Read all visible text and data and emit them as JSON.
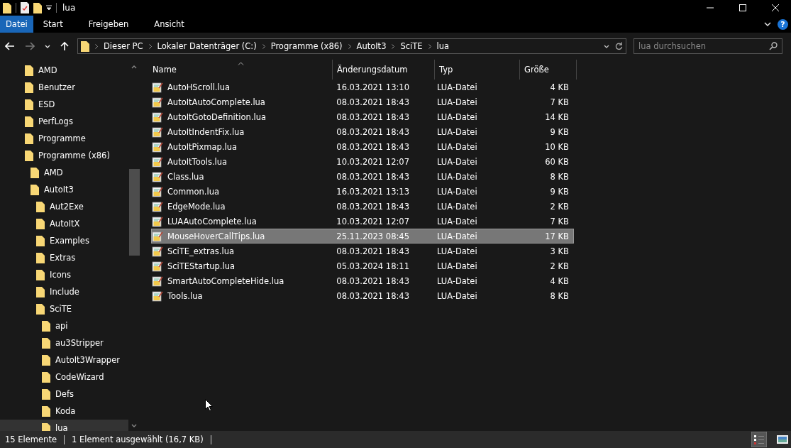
{
  "window": {
    "title": "lua"
  },
  "ribbon": {
    "tabs": [
      {
        "label": "Datei",
        "selected": true
      },
      {
        "label": "Start",
        "selected": false
      },
      {
        "label": "Freigeben",
        "selected": false
      },
      {
        "label": "Ansicht",
        "selected": false
      }
    ],
    "help": "?"
  },
  "address_bar": {
    "breadcrumbs": [
      "Dieser PC",
      "Lokaler Datenträger (C:)",
      "Programme (x86)",
      "AutoIt3",
      "SciTE",
      "lua"
    ]
  },
  "search": {
    "placeholder": "lua durchsuchen"
  },
  "sidebar": {
    "items": [
      {
        "label": "AMD",
        "selected": false
      },
      {
        "label": "Benutzer",
        "selected": false
      },
      {
        "label": "ESD",
        "selected": false
      },
      {
        "label": "PerfLogs",
        "selected": false
      },
      {
        "label": "Programme",
        "selected": false
      },
      {
        "label": "Programme (x86)",
        "selected": false,
        "children": [
          {
            "label": "AMD",
            "selected": false
          },
          {
            "label": "AutoIt3",
            "selected": false,
            "children": [
              {
                "label": "Aut2Exe",
                "selected": false
              },
              {
                "label": "AutoItX",
                "selected": false
              },
              {
                "label": "Examples",
                "selected": false
              },
              {
                "label": "Extras",
                "selected": false
              },
              {
                "label": "Icons",
                "selected": false
              },
              {
                "label": "Include",
                "selected": false
              },
              {
                "label": "SciTE",
                "selected": false,
                "children": [
                  {
                    "label": "api",
                    "selected": false
                  },
                  {
                    "label": "au3Stripper",
                    "selected": false
                  },
                  {
                    "label": "AutoIt3Wrapper",
                    "selected": false
                  },
                  {
                    "label": "CodeWizard",
                    "selected": false
                  },
                  {
                    "label": "Defs",
                    "selected": false
                  },
                  {
                    "label": "Koda",
                    "selected": false
                  },
                  {
                    "label": "lua",
                    "selected": true
                  }
                ]
              }
            ]
          }
        ]
      }
    ]
  },
  "table": {
    "columns": [
      "Name",
      "Änderungsdatum",
      "Typ",
      "Größe"
    ],
    "rows": [
      {
        "name": "AutoHScroll.lua",
        "date": "16.03.2021 13:10",
        "type": "LUA-Datei",
        "size": "4 KB",
        "selected": false
      },
      {
        "name": "AutoItAutoComplete.lua",
        "date": "08.03.2021 18:43",
        "type": "LUA-Datei",
        "size": "7 KB",
        "selected": false
      },
      {
        "name": "AutoItGotoDefinition.lua",
        "date": "08.03.2021 18:43",
        "type": "LUA-Datei",
        "size": "14 KB",
        "selected": false
      },
      {
        "name": "AutoItIndentFix.lua",
        "date": "08.03.2021 18:43",
        "type": "LUA-Datei",
        "size": "9 KB",
        "selected": false
      },
      {
        "name": "AutoItPixmap.lua",
        "date": "08.03.2021 18:43",
        "type": "LUA-Datei",
        "size": "10 KB",
        "selected": false
      },
      {
        "name": "AutoItTools.lua",
        "date": "10.03.2021 12:07",
        "type": "LUA-Datei",
        "size": "60 KB",
        "selected": false
      },
      {
        "name": "Class.lua",
        "date": "08.03.2021 18:43",
        "type": "LUA-Datei",
        "size": "8 KB",
        "selected": false
      },
      {
        "name": "Common.lua",
        "date": "16.03.2021 13:13",
        "type": "LUA-Datei",
        "size": "9 KB",
        "selected": false
      },
      {
        "name": "EdgeMode.lua",
        "date": "08.03.2021 18:43",
        "type": "LUA-Datei",
        "size": "2 KB",
        "selected": false
      },
      {
        "name": "LUAAutoComplete.lua",
        "date": "10.03.2021 12:07",
        "type": "LUA-Datei",
        "size": "7 KB",
        "selected": false
      },
      {
        "name": "MouseHoverCallTips.lua",
        "date": "25.11.2023 08:45",
        "type": "LUA-Datei",
        "size": "17 KB",
        "selected": true
      },
      {
        "name": "SciTE_extras.lua",
        "date": "08.03.2021 18:43",
        "type": "LUA-Datei",
        "size": "3 KB",
        "selected": false
      },
      {
        "name": "SciTEStartup.lua",
        "date": "05.03.2024 18:11",
        "type": "LUA-Datei",
        "size": "2 KB",
        "selected": false
      },
      {
        "name": "SmartAutoCompleteHide.lua",
        "date": "08.03.2021 18:43",
        "type": "LUA-Datei",
        "size": "4 KB",
        "selected": false
      },
      {
        "name": "Tools.lua",
        "date": "08.03.2021 18:43",
        "type": "LUA-Datei",
        "size": "8 KB",
        "selected": false
      }
    ]
  },
  "status_bar": {
    "item_count": "15 Elemente",
    "selection": "1 Element ausgewählt (16,7 KB)"
  }
}
